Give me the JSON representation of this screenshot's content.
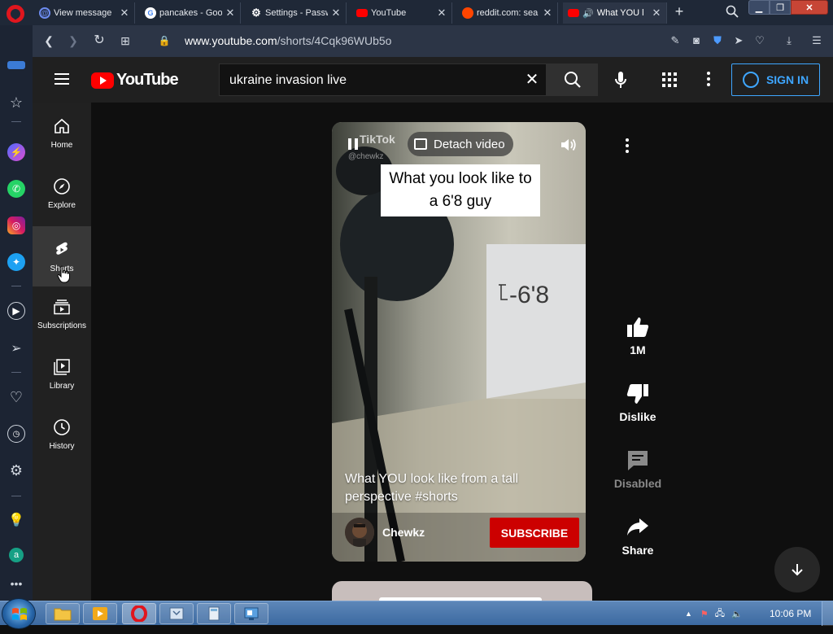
{
  "browser": {
    "tabs": [
      {
        "label": "View message",
        "favicon": "at-icon",
        "color": "#3b5fc7"
      },
      {
        "label": "pancakes - Goo",
        "favicon": "google-icon",
        "color": "#ffffff"
      },
      {
        "label": "Settings - Passw",
        "favicon": "gear-icon",
        "color": "#ffffff"
      },
      {
        "label": "YouTube",
        "favicon": "youtube-icon",
        "color": "#ff0000"
      },
      {
        "label": "reddit.com: sea",
        "favicon": "reddit-icon",
        "color": "#ff4500"
      },
      {
        "label": "What YOU l",
        "favicon": "youtube-icon",
        "color": "#ff0000"
      }
    ],
    "url_host": "www.youtube.com",
    "url_path": "/shorts/4Cqk96WUb5o"
  },
  "youtube": {
    "logo_text": "YouTube",
    "search_value": "ukraine invasion live",
    "sign_in": "SIGN IN",
    "guide": [
      {
        "label": "Home",
        "icon": "home-icon"
      },
      {
        "label": "Explore",
        "icon": "compass-icon"
      },
      {
        "label": "Shorts",
        "icon": "shorts-icon"
      },
      {
        "label": "Subscriptions",
        "icon": "subscriptions-icon"
      },
      {
        "label": "Library",
        "icon": "library-icon"
      },
      {
        "label": "History",
        "icon": "history-icon"
      }
    ]
  },
  "short": {
    "detach_label": "Detach video",
    "watermark": "TikTok",
    "watermark_user": "@chewkz",
    "caption": "What you look like to a 6'8 guy",
    "title": "What YOU look like from a tall perspective #shorts",
    "channel": "Chewkz",
    "subscribe": "SUBSCRIBE"
  },
  "actions": {
    "like_count": "1M",
    "dislike": "Dislike",
    "comments": "Disabled",
    "share": "Share"
  },
  "taskbar": {
    "clock": "10:06 PM"
  },
  "colors": {
    "yt_red": "#ff0000",
    "subscribe_red": "#cc0000",
    "signin_blue": "#3ea6ff",
    "opera_red": "#e0161e"
  }
}
